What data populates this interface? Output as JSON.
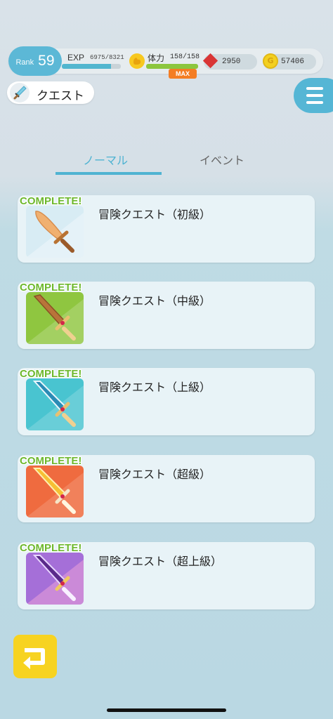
{
  "header": {
    "rank_label": "Rank",
    "rank_value": "59",
    "exp_label": "EXP",
    "exp_value": "6975/8321",
    "exp_fraction": 0.838,
    "stamina_label": "体力",
    "stamina_value": "158/158",
    "stamina_fraction": 1.0,
    "max_badge": "MAX",
    "gems": "2950",
    "coins": "57406",
    "coin_symbol": "G"
  },
  "quest_chip": {
    "label": "クエスト",
    "icon": "sword-icon"
  },
  "menu": {
    "icon": "hamburger-menu-icon"
  },
  "tabs": [
    {
      "label": "ノーマル",
      "active": true
    },
    {
      "label": "イベント",
      "active": false
    }
  ],
  "quests": [
    {
      "badge": "COMPLETE!",
      "title": "冒険クエスト（初級）",
      "icon": "wooden-sword-icon",
      "bg": "#d8ecf4"
    },
    {
      "badge": "COMPLETE!",
      "title": "冒険クエスト（中級）",
      "icon": "bronze-sword-icon",
      "bg": "#8fc640"
    },
    {
      "badge": "COMPLETE!",
      "title": "冒険クエスト（上級）",
      "icon": "steel-sword-icon",
      "bg": "#49c4d0"
    },
    {
      "badge": "COMPLETE!",
      "title": "冒険クエスト（超級）",
      "icon": "golden-sword-icon",
      "bg": "#ef6b3f"
    },
    {
      "badge": "COMPLETE!",
      "title": "冒険クエスト（超上級）",
      "icon": "violet-sword-icon",
      "bg": "#a56fd8"
    }
  ],
  "back_button": {
    "icon": "return-arrow-icon"
  },
  "colors": {
    "accent": "#4fb3d2",
    "complete": "#6db82d",
    "back_button": "#f7d321",
    "max_badge": "#f47d23"
  }
}
